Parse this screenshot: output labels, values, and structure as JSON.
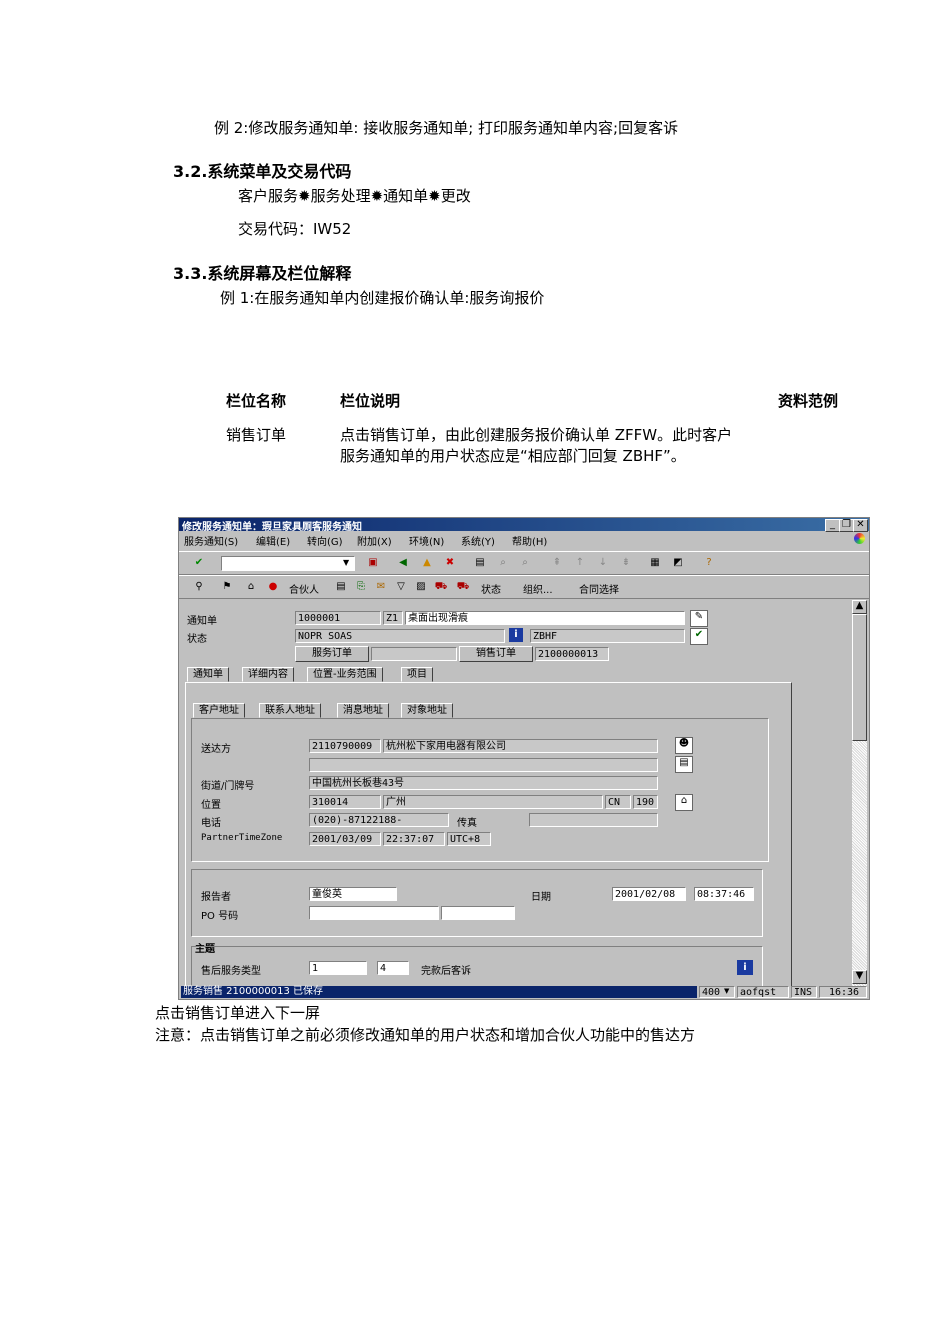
{
  "doc": {
    "example2": "例 2:修改服务通知单: 接收服务通知单; 打印服务通知单内容;回复客诉",
    "sec32_title": "3.2.系统菜单及交易代码",
    "menu_path": "客户服务✹服务处理✹通知单✹更改",
    "tcode": "交易代码：IW52",
    "sec33_title": "3.3.系统屏幕及栏位解释",
    "example1": "例 1:在服务通知单内创建报价确认单:服务询报价",
    "col_name": "栏位名称",
    "col_desc": "栏位说明",
    "col_sample": "资料范例",
    "row1_name": "销售订单",
    "row1_desc_line1": "点击销售订单，由此创建服务报价确认单 ZFFW。此时客户",
    "row1_desc_line2": "服务通知单的用户状态应是“相应部门回复 ZBHF”。",
    "note1": "点击销售订单进入下一屏",
    "note2": "注意：点击销售订单之前必须修改通知单的用户状态和增加合伙人功能中的售达方"
  },
  "sap": {
    "title": "修改服务通知单：瑕旦家具厕客服务通知",
    "menus": [
      "服务通知(S)",
      "编辑(E)",
      "转向(G)",
      "附加(X)",
      "环境(N)",
      "系统(Y)",
      "帮助(H)"
    ],
    "toolbar2": {
      "partner": "合伙人",
      "status": "状态",
      "org": "组织...",
      "contract": "合同选择"
    },
    "labels": {
      "notif": "通知单",
      "status": "状态",
      "service_order": "服务订单",
      "sales_order": "销售订单"
    },
    "values": {
      "notif_no": "1000001",
      "notif_type": "Z1",
      "notif_desc": "桌面出现滑痕",
      "sys_status": "NOPR SOAS",
      "user_status": "ZBHF",
      "sales_order_no": "2100000013"
    },
    "tabs": [
      "通知单",
      "详细内容",
      "位置-业务范围",
      "项目"
    ],
    "subtabs": [
      "客户地址",
      "联系人地址",
      "消息地址",
      "对象地址"
    ],
    "address": {
      "sold_to_label": "送达方",
      "sold_to_no": "2110790009",
      "sold_to_name": "杭州松下家用电器有限公司",
      "street_label": "街道/门牌号",
      "street": "中国杭州长板巷43号",
      "location_label": "位置",
      "postcode": "310014",
      "city": "广州",
      "country": "CN",
      "region": "190",
      "phone_label": "电话",
      "phone": "(020)-87122188-",
      "fax_label": "传真",
      "tz_label": "PartnerTimeZone",
      "tz_date": "2001/03/09",
      "tz_time": "22:37:07",
      "tz_zone": "UTC+8"
    },
    "reporter": {
      "reporter_label": "报告者",
      "reporter": "童俊英",
      "date_label": "日期",
      "date": "2001/02/08",
      "time": "08:37:46",
      "po_label": "PO 号码"
    },
    "subject": {
      "title": "主题",
      "svc_type_label": "售后服务类型",
      "svc_type_1": "1",
      "svc_type_2": "4",
      "svc_type_text": "完款后客诉"
    },
    "statusbar": {
      "message": "服务销售 2100000013 已保存",
      "client": "400",
      "server": "aofqst",
      "mode": "INS",
      "time": "16:36"
    }
  }
}
